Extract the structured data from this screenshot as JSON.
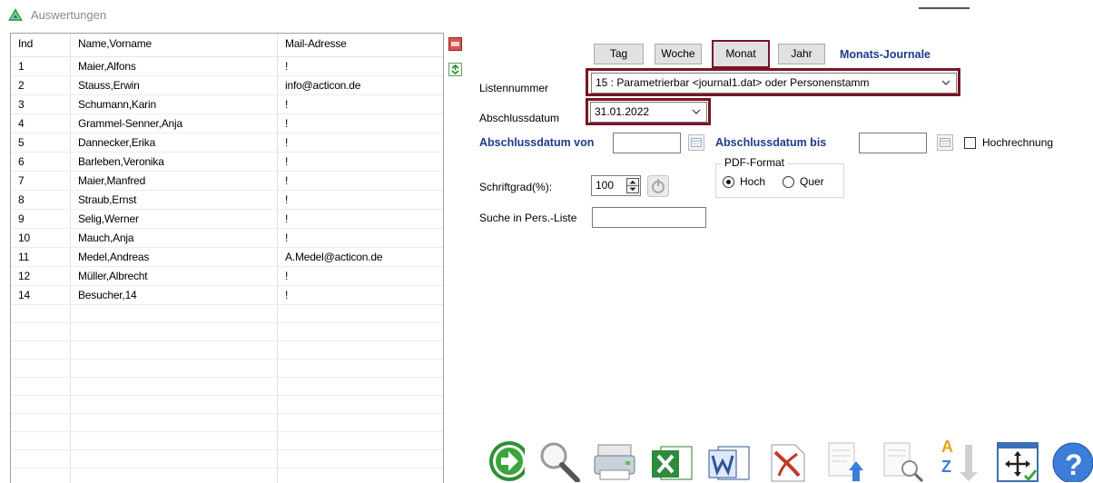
{
  "window": {
    "title": "Auswertungen"
  },
  "table": {
    "columns": [
      "Ind",
      "Name,Vorname",
      "Mail-Adresse"
    ],
    "rows": [
      [
        "1",
        "Maier,Alfons",
        "!"
      ],
      [
        "2",
        "Stauss,Erwin",
        "info@acticon.de"
      ],
      [
        "3",
        "Schumann,Karin",
        "!"
      ],
      [
        "4",
        "Grammel-Senner,Anja",
        "!"
      ],
      [
        "5",
        "Dannecker,Erika",
        "!"
      ],
      [
        "6",
        "Barleben,Veronika",
        "!"
      ],
      [
        "7",
        "Maier,Manfred",
        "!"
      ],
      [
        "8",
        "Straub,Ernst",
        "!"
      ],
      [
        "9",
        "Selig,Werner",
        "!"
      ],
      [
        "10",
        "Mauch,Anja",
        "!"
      ],
      [
        "11",
        "Medel,Andreas",
        "A.Medel@acticon.de"
      ],
      [
        "12",
        "Müller,Albrecht",
        "!"
      ],
      [
        "14",
        "Besucher,14",
        "!"
      ]
    ]
  },
  "period_tabs": {
    "tag": "Tag",
    "woche": "Woche",
    "monat": "Monat",
    "jahr": "Jahr",
    "selected": "Monat"
  },
  "journal_title": "Monats-Journale",
  "listennummer": {
    "label": "Listennummer",
    "value": "15 : Parametrierbar <journal1.dat> oder Personenstamm"
  },
  "abschlussdatum": {
    "label": "Abschlussdatum",
    "value": "31.01.2022"
  },
  "range": {
    "von_label": "Abschlussdatum von",
    "von_value": "",
    "bis_label": "Abschlussdatum bis",
    "bis_value": ""
  },
  "hochrechnung": {
    "label": "Hochrechnung",
    "checked": false
  },
  "schriftgrad": {
    "label": "Schriftgrad(%):",
    "value": "100"
  },
  "pdf_format": {
    "title": "PDF-Format",
    "hoch": "Hoch",
    "quer": "Quer",
    "selected": "Hoch"
  },
  "suche": {
    "label": "Suche in Pers.-Liste",
    "value": ""
  },
  "colors": {
    "accent_frame": "#7a1426",
    "blue_label": "#1f3a8a"
  },
  "toolbar": [
    "arrow-right-icon",
    "magnifier-icon",
    "printer-icon",
    "excel-icon",
    "word-icon",
    "pdf-icon",
    "export-upload-icon",
    "document-search-icon",
    "sort-az-icon",
    "move-window-icon",
    "help-icon"
  ]
}
